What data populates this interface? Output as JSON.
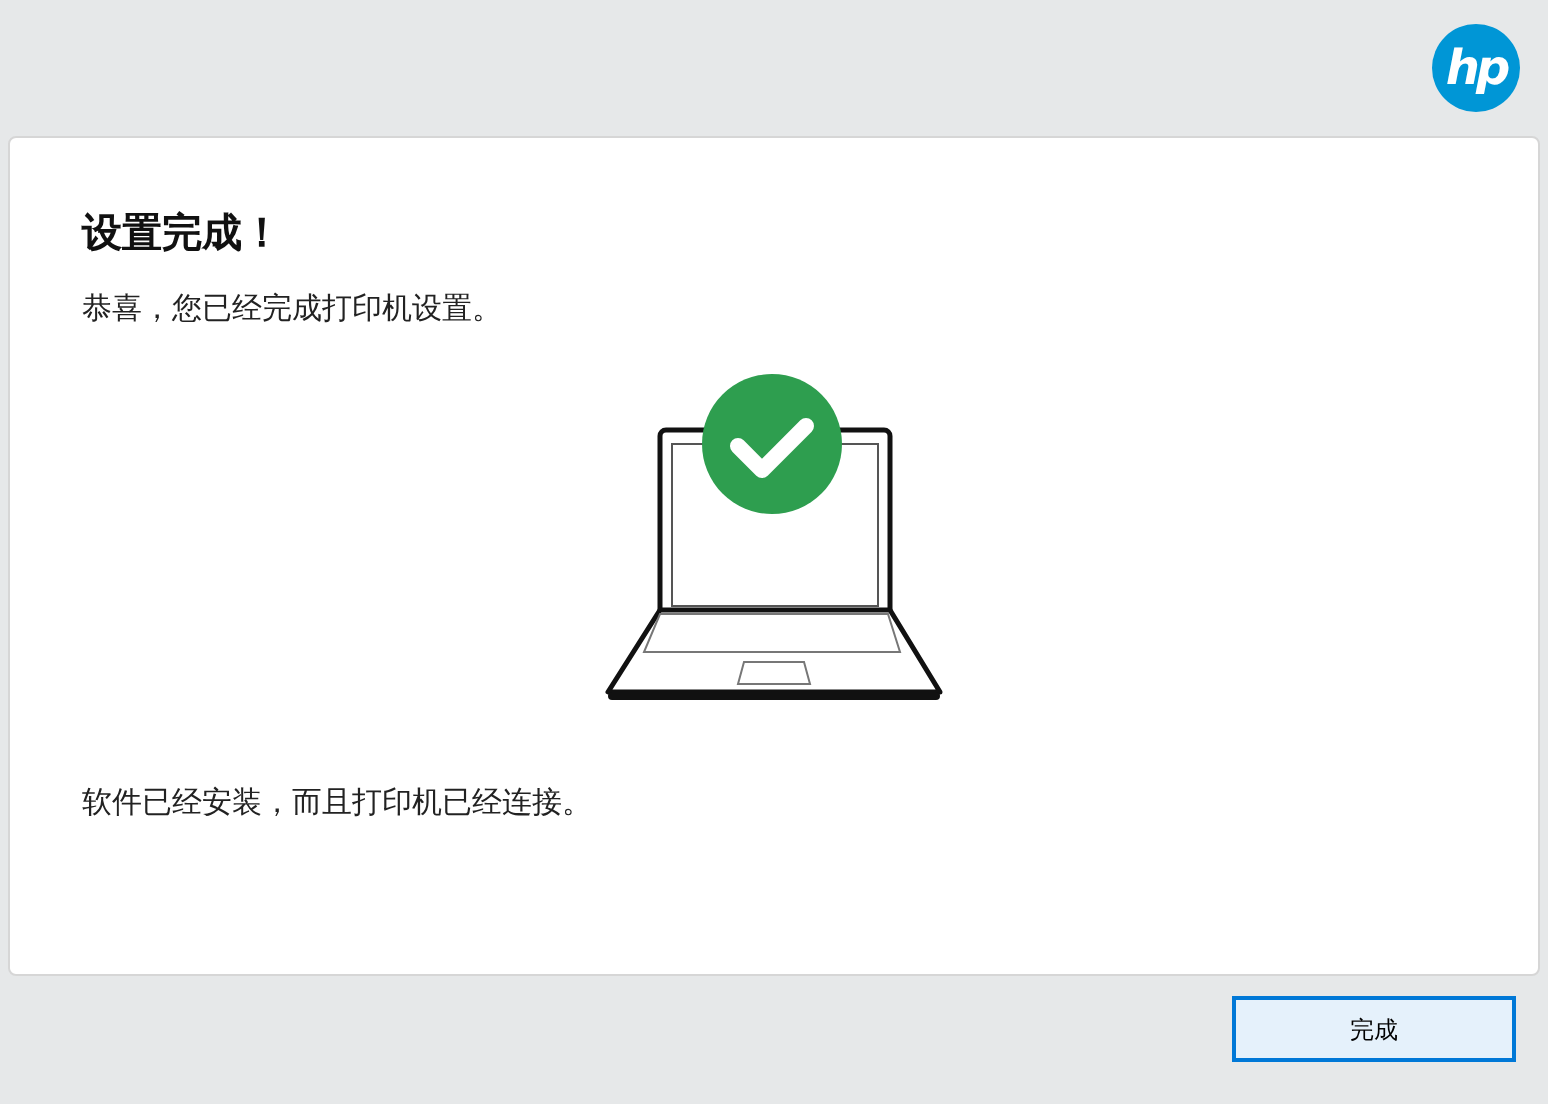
{
  "logo": {
    "text": "hp"
  },
  "title": "设置完成！",
  "message": "恭喜，您已经完成打印机设置。",
  "status": "软件已经安装，而且打印机已经连接。",
  "buttons": [
    {
      "label": "完成",
      "selected": true
    }
  ]
}
